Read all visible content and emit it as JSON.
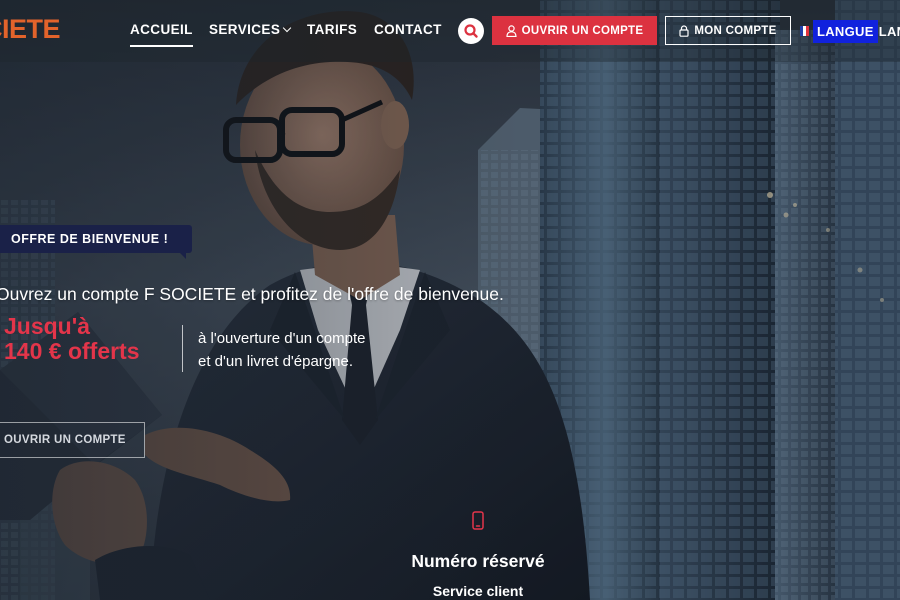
{
  "colors": {
    "brand": "#e2632b",
    "accent_red": "#dc3240",
    "badge_bg": "#1a2148",
    "lang_highlight": "#1122dd"
  },
  "header": {
    "logo_text": "SOCIETE",
    "nav": [
      {
        "label": "ACCUEIL",
        "active": true
      },
      {
        "label": "SERVICES",
        "has_dropdown": true
      },
      {
        "label": "TARIFS"
      },
      {
        "label": "CONTACT"
      }
    ],
    "search_icon": "search-icon",
    "open_account_label": "OUVRIR UN COMPTE",
    "open_account_icon": "user-icon",
    "my_account_label": "MON COMPTE",
    "my_account_icon": "lock-icon",
    "language_flag": "french-flag-icon",
    "language_label": "LANGUE",
    "language_label_repeat": "LAN"
  },
  "hero": {
    "badge": "OFFRE DE BIENVENUE !",
    "intro": "Ouvrez un compte F SOCIETE et profitez de l'offre de bienvenue.",
    "offer_line1": "Jusqu'à",
    "offer_line2": "140 € offerts",
    "offer_desc_line1": "à l'ouverture d'un compte",
    "offer_desc_line2": "et d'un livret d'épargne.",
    "cta_label": "OUVRIR UN COMPTE"
  },
  "service": {
    "icon": "mobile-phone-icon",
    "title": "Numéro réservé",
    "subtitle": "Service client"
  }
}
